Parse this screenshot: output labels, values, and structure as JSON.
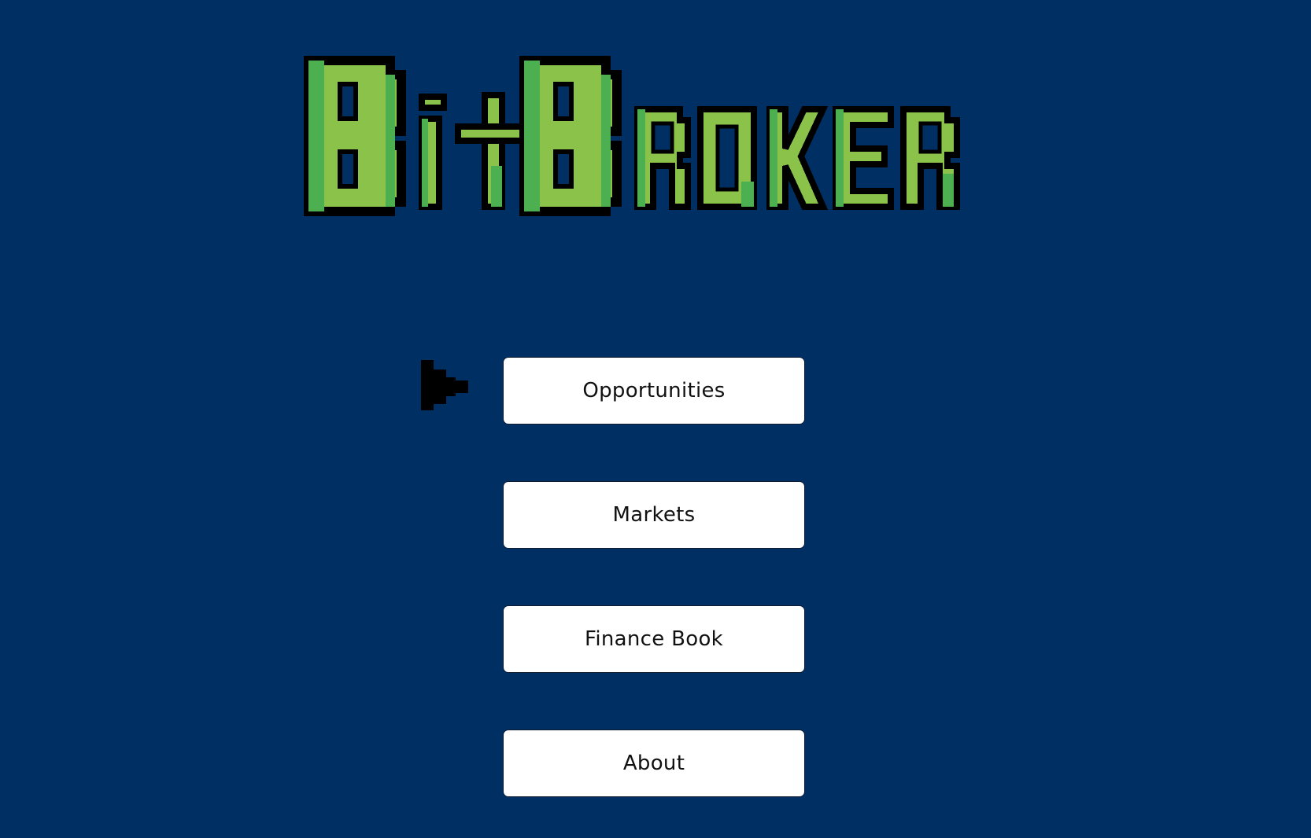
{
  "logo_text": "BitBroker",
  "colors": {
    "background": "#003063",
    "logo_light_green": "#8bc34a",
    "logo_dark_green": "#4caf50",
    "logo_outline": "#000000",
    "button_bg": "#ffffff"
  },
  "menu": {
    "items": [
      {
        "label": "Opportunities",
        "selected": true
      },
      {
        "label": "Markets",
        "selected": false
      },
      {
        "label": "Finance Book",
        "selected": false
      },
      {
        "label": "About",
        "selected": false
      }
    ]
  },
  "selector_icon": "pixel-arrow-right"
}
